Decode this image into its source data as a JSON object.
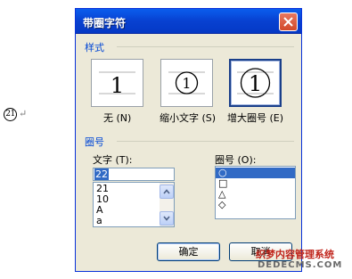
{
  "document": {
    "enclosed_char": "21",
    "paragraph_mark": "↵"
  },
  "dialog": {
    "title": "带圈字符",
    "style_group": {
      "label": "样式",
      "options": [
        {
          "label": "无 (N)",
          "preview": "1",
          "selected": false
        },
        {
          "label": "缩小文字 (S)",
          "preview": "1",
          "selected": false
        },
        {
          "label": "增大圈号 (E)",
          "preview": "1",
          "selected": true
        }
      ]
    },
    "enclose_group": {
      "label": "圈号",
      "text_label": "文字 (T):",
      "text_value": "22",
      "text_list": [
        "21",
        "10",
        "A",
        "a"
      ],
      "shape_label": "圈号 (O):",
      "shapes": [
        {
          "symbol": "○",
          "name": "circle"
        },
        {
          "symbol": "□",
          "name": "square"
        },
        {
          "symbol": "△",
          "name": "triangle"
        },
        {
          "symbol": "◇",
          "name": "diamond"
        }
      ],
      "selected_shape_index": 0
    },
    "buttons": {
      "ok": "确定",
      "cancel": "取消"
    }
  },
  "watermark": {
    "line1": "织梦内容管理系统",
    "line2": "DEDECMS.COM"
  },
  "colors": {
    "titlebar": "#0a5ded",
    "selection": "#316ac5",
    "dialog_face": "#ece9d8",
    "group_text": "#0046d5"
  }
}
